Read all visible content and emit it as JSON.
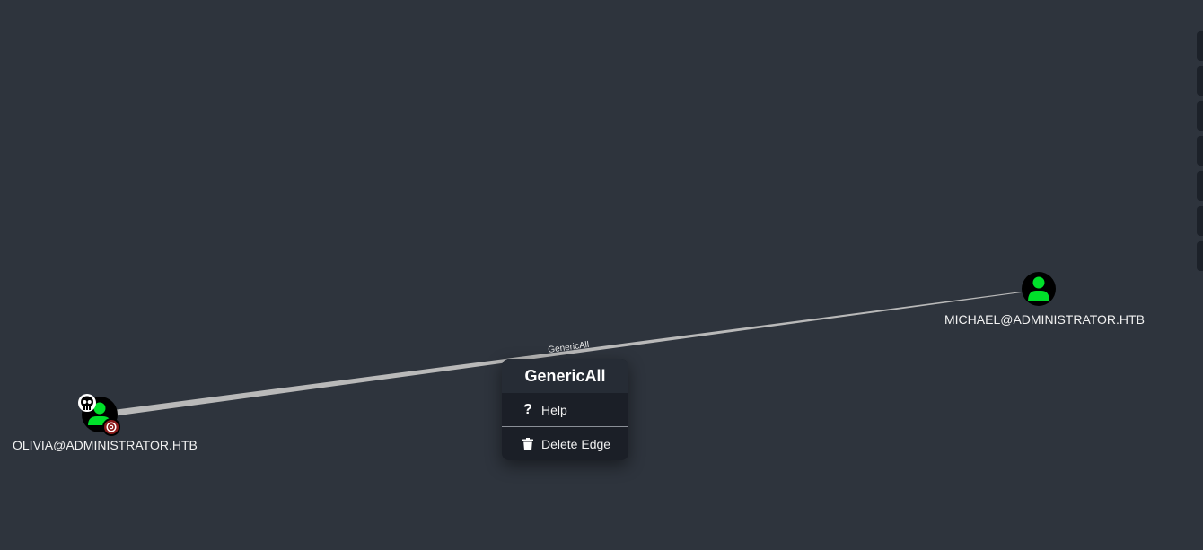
{
  "graph": {
    "nodes": [
      {
        "id": "olivia",
        "label": "OLIVIA@ADMINISTRATOR.HTB",
        "type": "user",
        "owned": true,
        "high_value_target": true
      },
      {
        "id": "michael",
        "label": "MICHAEL@ADMINISTRATOR.HTB",
        "type": "user",
        "owned": false,
        "high_value_target": false
      }
    ],
    "edges": [
      {
        "from": "olivia",
        "to": "michael",
        "label": "GenericAll"
      }
    ]
  },
  "context_menu": {
    "title": "GenericAll",
    "items": [
      {
        "label": "Help",
        "icon": "question-icon"
      },
      {
        "label": "Delete Edge",
        "icon": "trash-icon"
      }
    ]
  },
  "colors": {
    "background": "#2e343d",
    "user_node_fill": "#00e02a",
    "node_circle": "#000000",
    "edge": "#b9b9b9",
    "target_badge": "#8b1a1a"
  }
}
